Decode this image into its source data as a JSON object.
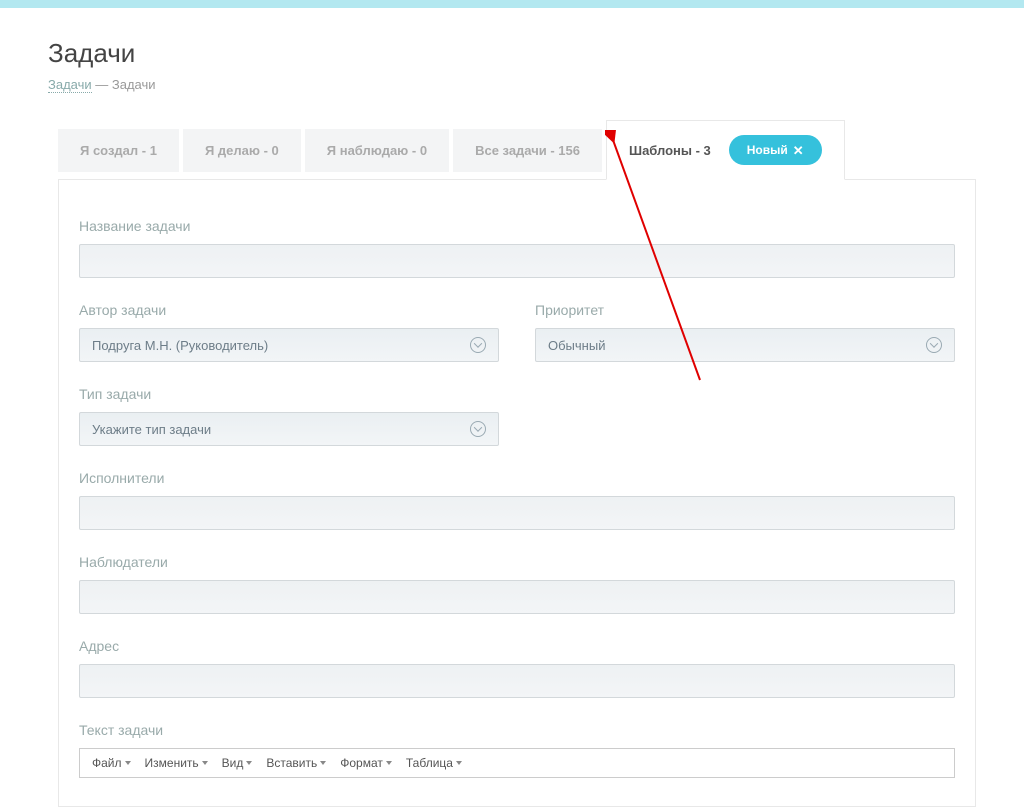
{
  "page": {
    "title": "Задачи"
  },
  "breadcrumb": {
    "root": "Задачи",
    "sep": " — ",
    "current": "Задачи"
  },
  "tabs": {
    "created": "Я создал - 1",
    "doing": "Я делаю - 0",
    "watching": "Я наблюдаю - 0",
    "all": "Все задачи - 156",
    "templates": "Шаблоны - 3"
  },
  "buttons": {
    "new": "Новый"
  },
  "form": {
    "task_name_label": "Название задачи",
    "author_label": "Автор задачи",
    "author_value": "Подруга М.Н. (Руководитель)",
    "priority_label": "Приоритет",
    "priority_value": "Обычный",
    "task_type_label": "Тип задачи",
    "task_type_placeholder": "Укажите тип задачи",
    "performers_label": "Исполнители",
    "observers_label": "Наблюдатели",
    "address_label": "Адрес",
    "task_text_label": "Текст задачи"
  },
  "editor": {
    "file": "Файл",
    "edit": "Изменить",
    "view": "Вид",
    "insert": "Вставить",
    "format": "Формат",
    "table": "Таблица"
  }
}
